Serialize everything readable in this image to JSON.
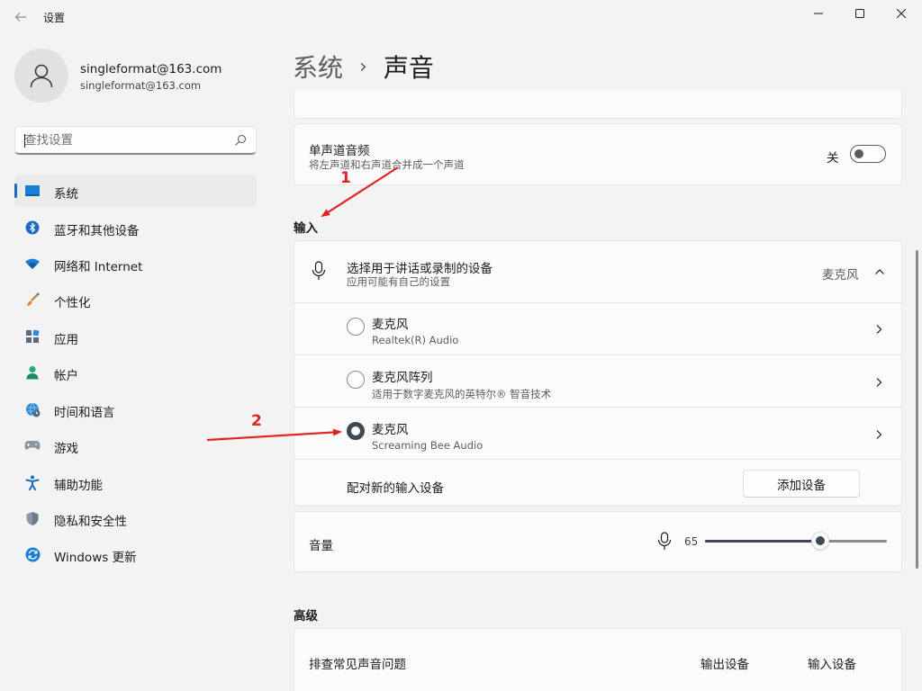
{
  "app": {
    "title": "设置",
    "back_icon": "back-arrow-icon",
    "window_controls": [
      "minimize-icon",
      "maximize-icon",
      "close-icon"
    ]
  },
  "user": {
    "name": "singleformat@163.com",
    "email": "singleformat@163.com"
  },
  "search": {
    "placeholder": "查找设置"
  },
  "nav": {
    "items": [
      {
        "label": "系统",
        "icon": "system-icon",
        "selected": true
      },
      {
        "label": "蓝牙和其他设备",
        "icon": "bluetooth-icon"
      },
      {
        "label": "网络和 Internet",
        "icon": "wifi-icon"
      },
      {
        "label": "个性化",
        "icon": "brush-icon"
      },
      {
        "label": "应用",
        "icon": "apps-icon"
      },
      {
        "label": "帐户",
        "icon": "account-icon"
      },
      {
        "label": "时间和语言",
        "icon": "globe-clock-icon"
      },
      {
        "label": "游戏",
        "icon": "gamepad-icon"
      },
      {
        "label": "辅助功能",
        "icon": "accessibility-icon"
      },
      {
        "label": "隐私和安全性",
        "icon": "shield-icon"
      },
      {
        "label": "Windows 更新",
        "icon": "update-icon"
      }
    ]
  },
  "header": {
    "parent": "系统",
    "separator": "›",
    "current": "声音"
  },
  "mono_audio": {
    "title": "单声道音频",
    "subtitle": "将左声道和右声道合并成一个声道",
    "state_label": "关",
    "enabled": false
  },
  "input_section": {
    "label": "输入",
    "choose_device": {
      "title": "选择用于讲话或录制的设备",
      "subtitle": "应用可能有自己的设置",
      "selected_value": "麦克风",
      "expanded": true
    },
    "devices": [
      {
        "name": "麦克风",
        "detail": "Realtek(R) Audio",
        "selected": false
      },
      {
        "name": "麦克风阵列",
        "detail": "适用于数字麦克风的英特尔® 智音技术",
        "selected": false
      },
      {
        "name": "麦克风",
        "detail": "Screaming Bee Audio",
        "selected": true
      }
    ],
    "pair_new": {
      "label": "配对新的输入设备",
      "button": "添加设备"
    }
  },
  "volume": {
    "label": "音量",
    "value": 65,
    "display": "65"
  },
  "advanced": {
    "label": "高级",
    "troubleshoot": "排查常见声音问题",
    "output_link": "输出设备",
    "input_link": "输入设备"
  },
  "annotations": [
    {
      "number": "1",
      "color": "#e52222"
    },
    {
      "number": "2",
      "color": "#e52222"
    }
  ],
  "colors": {
    "accent": "#1a6bbd",
    "annotation": "#e52222",
    "background": "#f3f3f3",
    "card": "#fbfbfb"
  }
}
